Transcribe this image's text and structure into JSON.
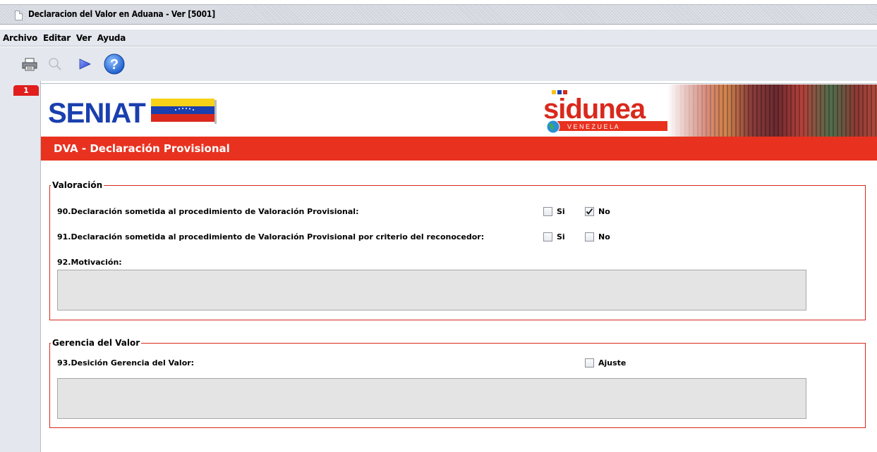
{
  "window": {
    "title": "Declaracion del Valor en Aduana - Ver [5001]"
  },
  "menu": [
    "Archivo",
    "Editar",
    "Ver",
    "Ayuda"
  ],
  "toolbar": {
    "icons": [
      "printer-icon",
      "magnifier-icon",
      "play-icon",
      "help-icon"
    ],
    "help_glyph": "?"
  },
  "page_tab": "1",
  "banner": {
    "left_logo_text": "SENIAT",
    "right_logo_text": "sidunea",
    "right_logo_sub": "V E N E Z U E L A"
  },
  "section_header": "DVA - Declaración Provisional",
  "valoracion": {
    "title": "Valoración",
    "q90": {
      "label": "90.Declaración sometida al procedimiento de Valoración Provisional:",
      "si_label": "Si",
      "si_checked": false,
      "no_label": "No",
      "no_checked": true
    },
    "q91": {
      "label": "91.Declaración sometida al procedimiento de Valoración Provisional por criterio del reconocedor:",
      "si_label": "Si",
      "si_checked": false,
      "no_label": "No",
      "no_checked": false
    },
    "q92": {
      "label": "92.Motivación:",
      "value": ""
    }
  },
  "gerencia": {
    "title": "Gerencia del Valor",
    "q93": {
      "label": "93.Desición Gerencia del Valor:",
      "ajuste_label": "Ajuste",
      "ajuste_checked": false,
      "value": ""
    }
  },
  "colors": {
    "accent_red": "#e8321f",
    "frame_red": "#d9291c",
    "chrome": "#e4e7ee"
  }
}
